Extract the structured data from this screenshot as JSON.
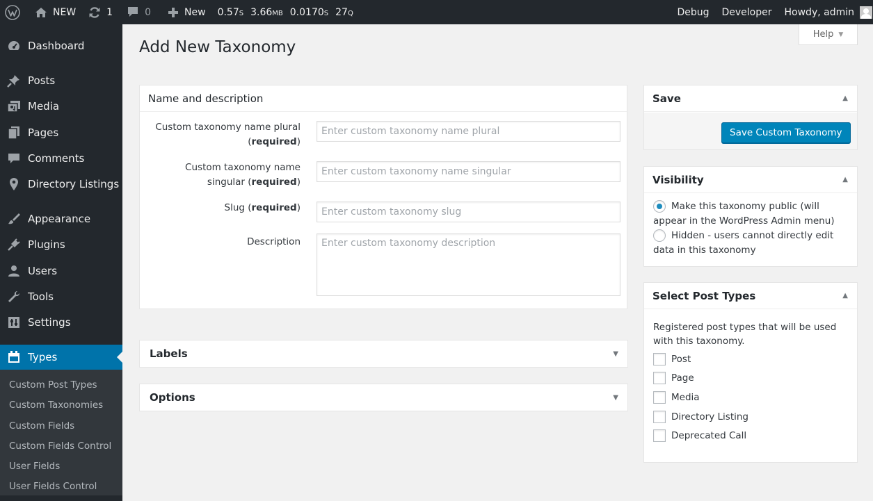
{
  "admin_bar": {
    "site_name": "NEW",
    "updates_count": "1",
    "comments_count": "0",
    "new_label": "New",
    "stats": [
      {
        "value": "0.57",
        "unit": "S"
      },
      {
        "value": "3.66",
        "unit": "MB"
      },
      {
        "value": "0.0170",
        "unit": "S"
      },
      {
        "value": "27",
        "unit": "Q"
      }
    ],
    "debug_label": "Debug",
    "developer_label": "Developer",
    "howdy_label": "Howdy, admin"
  },
  "sidebar": {
    "items": [
      {
        "label": "Dashboard",
        "icon": "dashboard-icon"
      },
      {
        "label": "Posts",
        "icon": "pin-icon"
      },
      {
        "label": "Media",
        "icon": "media-icon"
      },
      {
        "label": "Pages",
        "icon": "pages-icon"
      },
      {
        "label": "Comments",
        "icon": "comment-icon"
      },
      {
        "label": "Directory Listings",
        "icon": "location-icon"
      },
      {
        "label": "Appearance",
        "icon": "brush-icon"
      },
      {
        "label": "Plugins",
        "icon": "plug-icon"
      },
      {
        "label": "Users",
        "icon": "user-icon"
      },
      {
        "label": "Tools",
        "icon": "wrench-icon"
      },
      {
        "label": "Settings",
        "icon": "settings-icon"
      },
      {
        "label": "Types",
        "icon": "calendar-icon"
      }
    ],
    "submenu": [
      "Custom Post Types",
      "Custom Taxonomies",
      "Custom Fields",
      "Custom Fields Control",
      "User Fields",
      "User Fields Control"
    ]
  },
  "page": {
    "title": "Add New Taxonomy",
    "help_label": "Help"
  },
  "name_box": {
    "title": "Name and description",
    "required_word": "required",
    "fields": {
      "plural_label_a": "Custom taxonomy name plural",
      "plural_placeholder": "Enter custom taxonomy name plural",
      "singular_label_a": "Custom taxonomy name",
      "singular_label_b": "singular",
      "singular_placeholder": "Enter custom taxonomy name singular",
      "slug_label": "Slug",
      "slug_placeholder": "Enter custom taxonomy slug",
      "description_label": "Description",
      "description_placeholder": "Enter custom taxonomy description"
    }
  },
  "labels_box": {
    "title": "Labels"
  },
  "options_box": {
    "title": "Options"
  },
  "save_box": {
    "title": "Save",
    "button": "Save Custom Taxonomy"
  },
  "visibility_box": {
    "title": "Visibility",
    "options": [
      {
        "label": "Make this taxonomy public (will appear in the WordPress Admin menu)",
        "checked": true
      },
      {
        "label": "Hidden - users cannot directly edit data in this taxonomy",
        "checked": false
      }
    ]
  },
  "post_types_box": {
    "title": "Select Post Types",
    "description": "Registered post types that will be used with this taxonomy.",
    "types": [
      "Post",
      "Page",
      "Media",
      "Directory Listing",
      "Deprecated Call"
    ]
  },
  "colors": {
    "admin_bar_bg": "#23282d",
    "sidebar_bg": "#23282d",
    "submenu_bg": "#32373c",
    "active_menu": "#0073aa",
    "primary_button": "#0085ba",
    "page_bg": "#f1f1f1"
  }
}
